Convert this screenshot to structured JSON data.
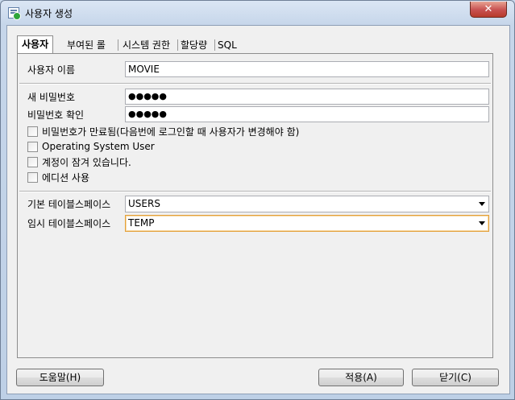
{
  "window": {
    "title": "사용자 생성",
    "close_label": "✕"
  },
  "tabs": [
    {
      "label": "사용자",
      "active": true
    },
    {
      "label": "부여된 롤"
    },
    {
      "label": "시스템 권한"
    },
    {
      "label": "할당량"
    },
    {
      "label": "SQL"
    }
  ],
  "form": {
    "username_label": "사용자 이름",
    "username_value": "MOVIE",
    "new_password_label": "새 비밀번호",
    "new_password_value": "●●●●●",
    "confirm_password_label": "비밀번호 확인",
    "confirm_password_value": "●●●●●",
    "checkboxes": [
      {
        "label": "비밀번호가 만료됨(다음번에 로그인할 때 사용자가 변경해야 함)",
        "checked": false
      },
      {
        "label": "Operating System User",
        "checked": false
      },
      {
        "label": "계정이 잠겨 있습니다.",
        "checked": false
      },
      {
        "label": "에디션 사용",
        "checked": false
      }
    ],
    "default_tablespace_label": "기본 테이블스페이스",
    "default_tablespace_value": "USERS",
    "temp_tablespace_label": "임시 테이블스페이스",
    "temp_tablespace_value": "TEMP"
  },
  "buttons": {
    "help": "도움말(H)",
    "apply": "적용(A)",
    "close": "닫기(C)"
  }
}
